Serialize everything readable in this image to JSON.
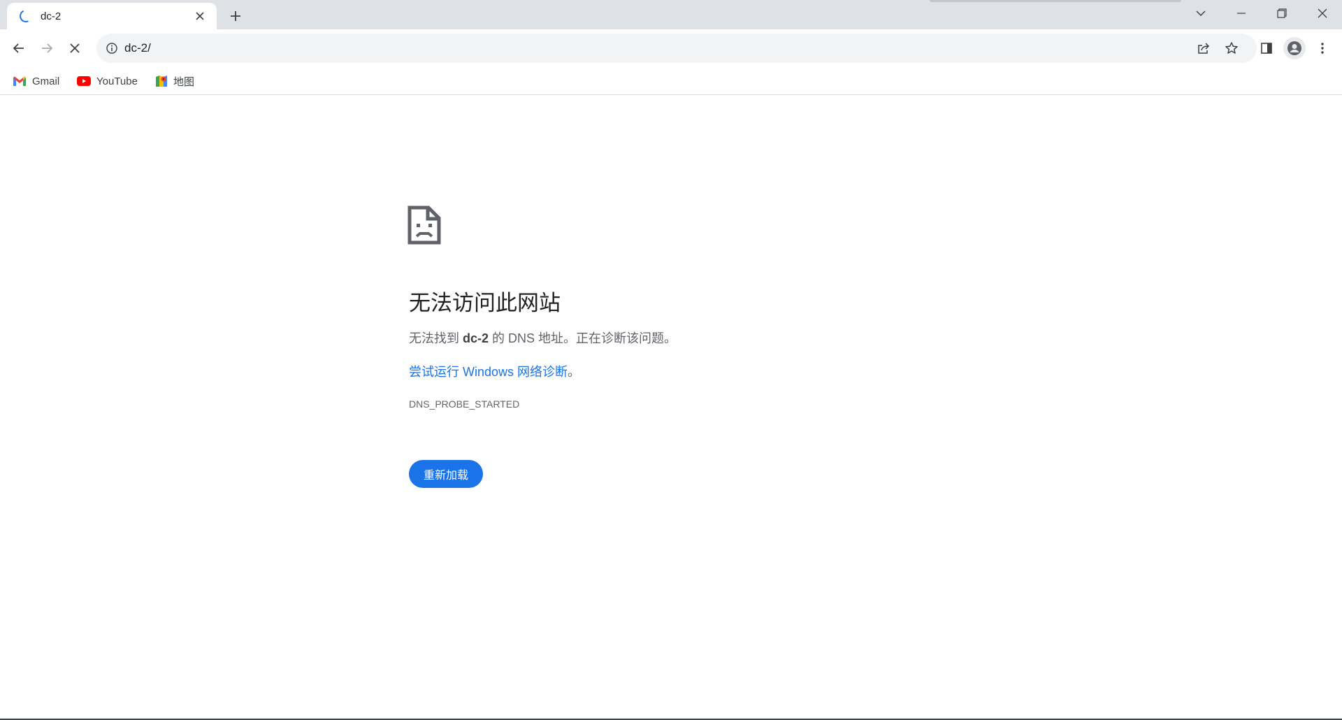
{
  "tab": {
    "title": "dc-2"
  },
  "omnibox": {
    "url": "dc-2/"
  },
  "bookmarks": [
    {
      "label": "Gmail",
      "icon": "gmail-icon"
    },
    {
      "label": "YouTube",
      "icon": "youtube-icon"
    },
    {
      "label": "地图",
      "icon": "maps-icon"
    }
  ],
  "error": {
    "title": "无法访问此网站",
    "desc_prefix": "无法找到 ",
    "desc_host": "dc-2",
    "desc_suffix": " 的 DNS 地址。正在诊断该问题。",
    "link_text": "尝试运行 Windows 网络诊断",
    "link_punct": "。",
    "code": "DNS_PROBE_STARTED",
    "reload_label": "重新加载"
  },
  "colors": {
    "accent": "#1a73e8",
    "tabstrip": "#dee1e6",
    "omnibox": "#f1f3f4"
  }
}
